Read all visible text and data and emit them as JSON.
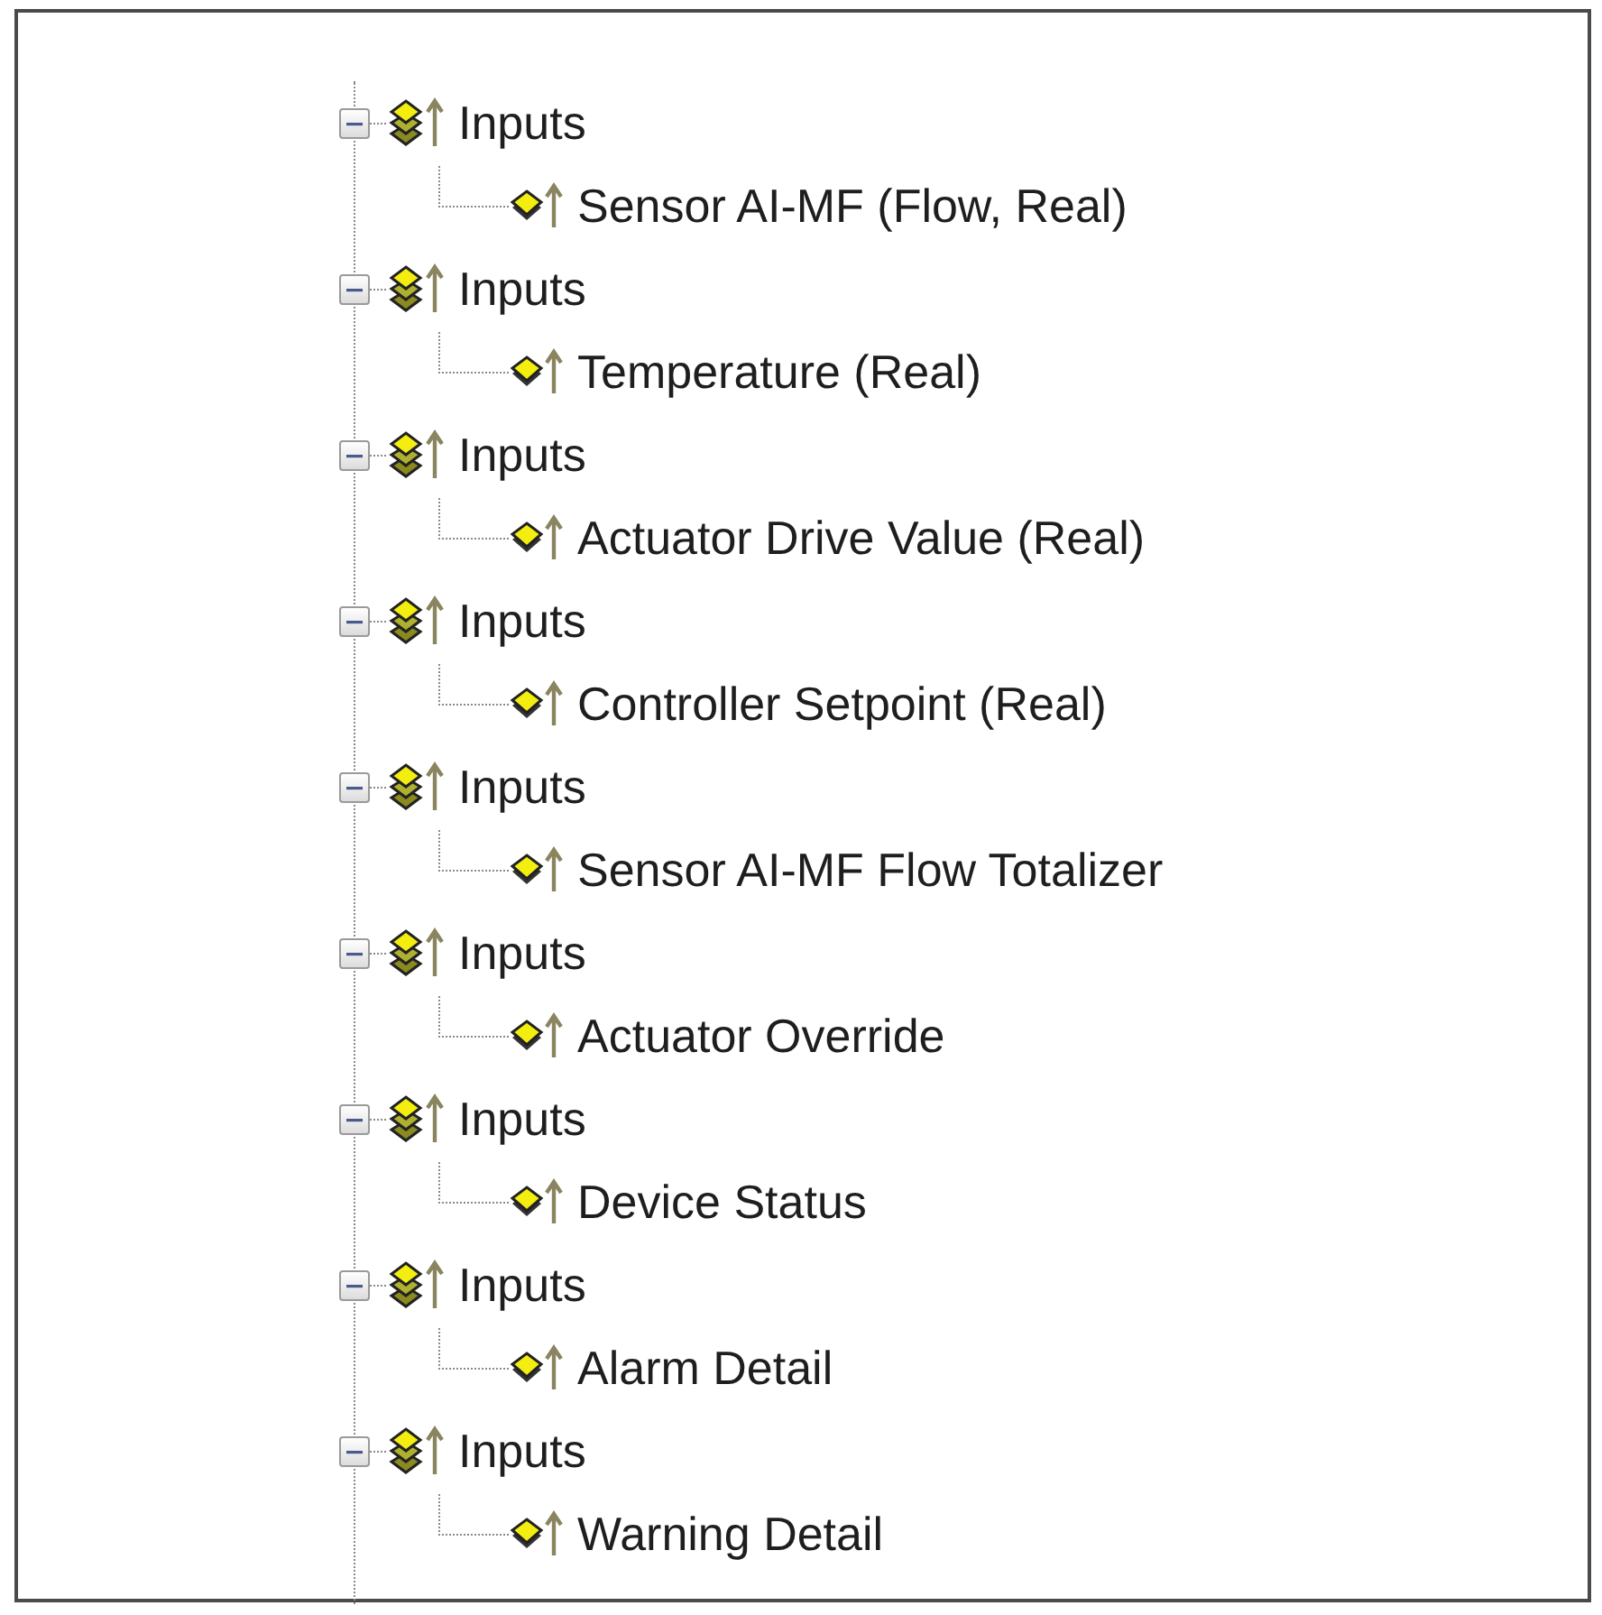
{
  "tree": [
    {
      "label": "Inputs",
      "expanded": true,
      "children": [
        {
          "label": "Sensor AI-MF (Flow, Real)"
        }
      ]
    },
    {
      "label": "Inputs",
      "expanded": true,
      "children": [
        {
          "label": "Temperature (Real)"
        }
      ]
    },
    {
      "label": "Inputs",
      "expanded": true,
      "children": [
        {
          "label": "Actuator Drive Value (Real)"
        }
      ]
    },
    {
      "label": "Inputs",
      "expanded": true,
      "children": [
        {
          "label": "Controller Setpoint (Real)"
        }
      ]
    },
    {
      "label": "Inputs",
      "expanded": true,
      "children": [
        {
          "label": "Sensor AI-MF Flow Totalizer"
        }
      ]
    },
    {
      "label": "Inputs",
      "expanded": true,
      "children": [
        {
          "label": "Actuator Override"
        }
      ]
    },
    {
      "label": "Inputs",
      "expanded": true,
      "children": [
        {
          "label": "Device Status"
        }
      ]
    },
    {
      "label": "Inputs",
      "expanded": true,
      "children": [
        {
          "label": "Alarm Detail"
        }
      ]
    },
    {
      "label": "Inputs",
      "expanded": true,
      "children": [
        {
          "label": "Warning Detail"
        }
      ]
    }
  ]
}
